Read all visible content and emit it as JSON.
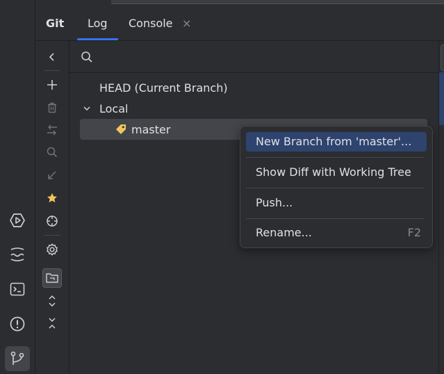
{
  "tabs": {
    "git": "Git",
    "log": "Log",
    "console": "Console",
    "close_glyph": "×"
  },
  "toolbar_icons": [
    "chevron-left-icon",
    "plus-icon",
    "trash-icon",
    "compare-icon",
    "search-icon",
    "arrow-down-left-icon",
    "star-icon",
    "crosshair-icon",
    "settings-icon",
    "group-by-directory-icon",
    "expand-all-icon",
    "collapse-all-icon"
  ],
  "activity_icons": [
    "services-icon",
    "python-console-icon",
    "terminal-icon",
    "problems-icon",
    "git-branch-icon"
  ],
  "search": {
    "placeholder": ""
  },
  "tree": {
    "head": "HEAD (Current Branch)",
    "local": "Local",
    "master": "master"
  },
  "context_menu": {
    "items": [
      {
        "label": "New Branch from 'master'...",
        "shortcut": ""
      },
      {
        "label": "Show Diff with Working Tree",
        "shortcut": ""
      },
      {
        "label": "Push...",
        "shortcut": ""
      },
      {
        "label": "Rename...",
        "shortcut": "F2"
      }
    ]
  },
  "colors": {
    "background": "#2b2d30",
    "accent": "#3574f0",
    "selection": "#2e436e",
    "star": "#f2c55c",
    "tag": "#f2c55c"
  }
}
